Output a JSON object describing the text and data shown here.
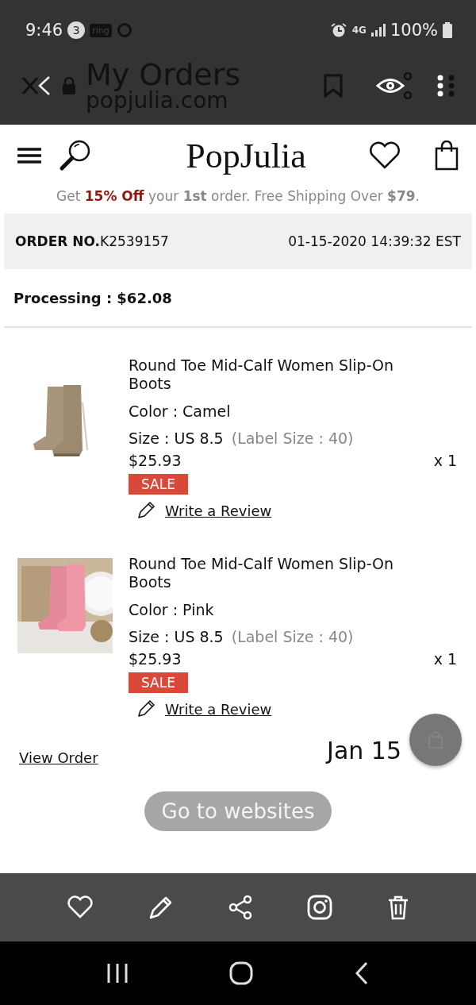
{
  "status_bar": {
    "time": "9:46",
    "notification_count": "3",
    "ring_label": "ring",
    "network": "4G",
    "battery": "100%"
  },
  "browser_bar": {
    "title": "My Orders",
    "url": "popjulia.com"
  },
  "site_header": {
    "logo": "PopJulia",
    "promo": "Get **15% Off** your **1st** order. Free Shipping Over **$79**."
  },
  "order": {
    "number_label": "ORDER NO.",
    "number": "K2539157",
    "date": "01-15-2020 14:39:32 EST",
    "status": "Processing : $62.08"
  },
  "items": [
    {
      "name": "Round Toe Mid-Calf Women Slip-On Boots",
      "color_label": "Color : Camel",
      "size": "Size : US 8.5",
      "label_size": "(Label Size : 40)",
      "price": "$25.93",
      "qty": "x 1",
      "badge": "SALE",
      "review": "Write a Review"
    },
    {
      "name": "Round Toe Mid-Calf Women Slip-On Boots",
      "color_label": "Color : Pink",
      "size": "Size : US 8.5",
      "label_size": "(Label Size : 40)",
      "price": "$25.93",
      "qty": "x 1",
      "badge": "SALE",
      "review": "Write a Review"
    }
  ],
  "view_order": "View Order",
  "date_badge": "Jan 15",
  "go_button": "Go to websites"
}
